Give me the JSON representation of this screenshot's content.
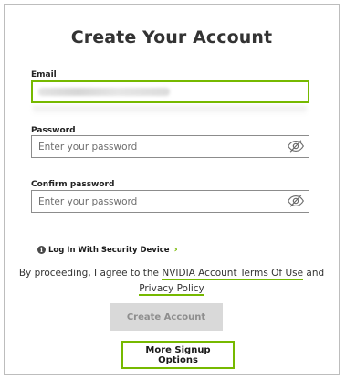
{
  "header": {
    "title": "Create Your Account"
  },
  "form": {
    "email": {
      "label": "Email",
      "value": "",
      "placeholder": ""
    },
    "password": {
      "label": "Password",
      "placeholder": "Enter your password"
    },
    "confirm_password": {
      "label": "Confirm password",
      "placeholder": "Enter your password"
    }
  },
  "security_link": {
    "label": "Log In With Security Device",
    "chevron": "›"
  },
  "agreement": {
    "prefix": "By proceeding, I agree to the ",
    "terms_link": "NVIDIA Account Terms Of Use",
    "conjunction": " and",
    "privacy_link": "Privacy Policy"
  },
  "actions": {
    "create_label": "Create Account",
    "more_signup_label": "More Signup Options"
  },
  "colors": {
    "accent": "#76b900",
    "disabled_bg": "#d9d9d9",
    "disabled_text": "#8e8e8e"
  },
  "icons": {
    "password_toggle": "eye-off-icon",
    "security_info": "info-icon",
    "chevron": "chevron-right-icon"
  }
}
